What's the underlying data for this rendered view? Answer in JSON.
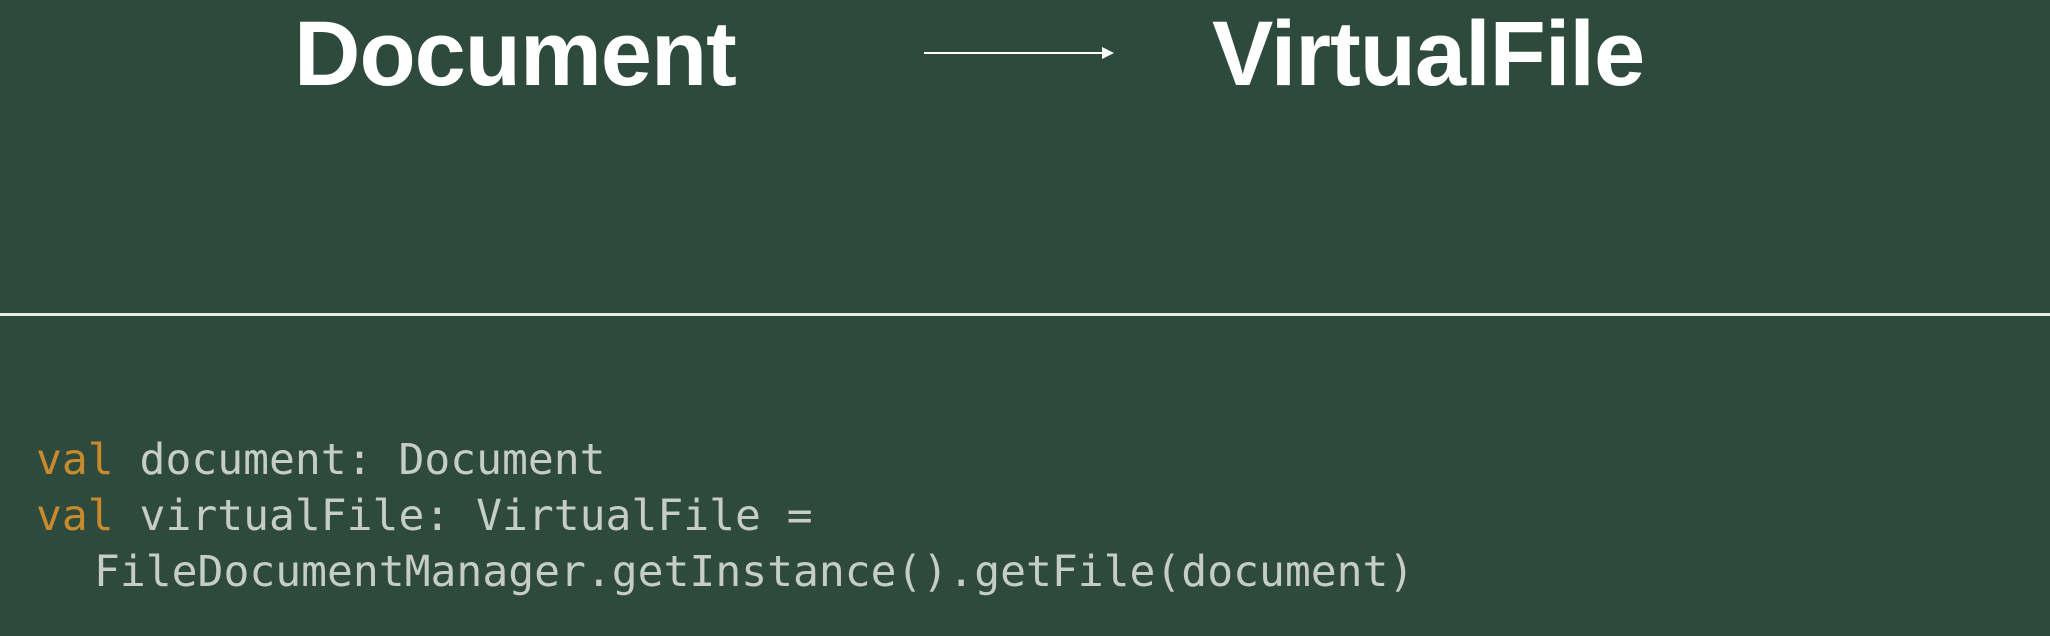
{
  "heading": {
    "left": "Document",
    "right": "VirtualFile"
  },
  "code": {
    "keyword": "val",
    "line1": " document: Document",
    "line2": " virtualFile: VirtualFile =",
    "line3": "FileDocumentManager.getInstance().getFile(document)"
  },
  "colors": {
    "background": "#2e4a3d",
    "heading": "#ffffff",
    "keyword": "#c98a2e",
    "code": "#c6ccc8",
    "divider": "#e6ede9"
  },
  "icons": {
    "arrow": "right-arrow-icon"
  }
}
